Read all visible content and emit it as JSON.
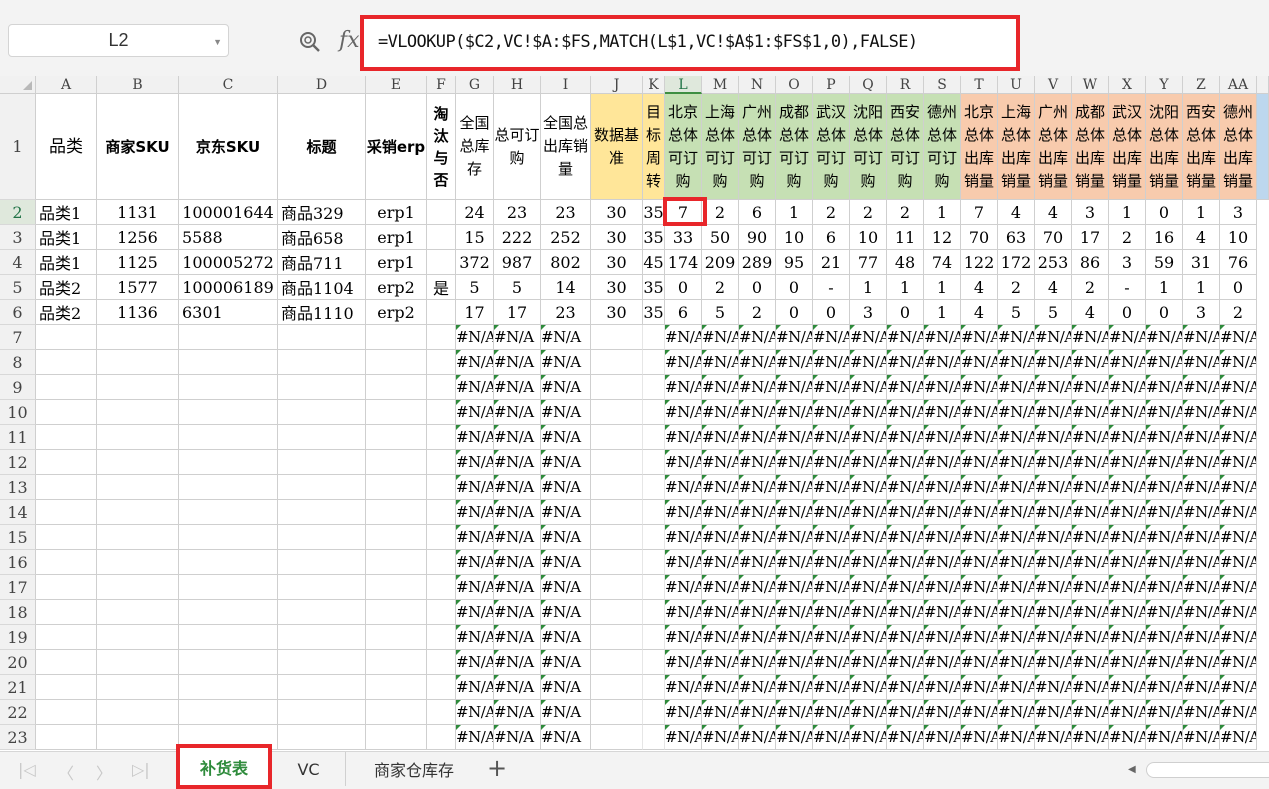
{
  "formula_bar": {
    "name_box": "L2",
    "fx_label": "fx",
    "formula": "=VLOOKUP($C2,VC!$A:$FS,MATCH(L$1,VC!$A$1:$FS$1,0),FALSE)"
  },
  "columns": [
    "A",
    "B",
    "C",
    "D",
    "E",
    "F",
    "G",
    "H",
    "I",
    "J",
    "K",
    "L",
    "M",
    "N",
    "O",
    "P",
    "Q",
    "R",
    "S",
    "T",
    "U",
    "V",
    "W",
    "X",
    "Y",
    "Z",
    "AA"
  ],
  "header_row": [
    "品类",
    "商家SKU",
    "京东SKU",
    "标题",
    "采销erp",
    "淘汰与否",
    "全国总库存",
    "总可订购",
    "全国总出库销量",
    "数据基准",
    "目标周转",
    "北京总体可订购",
    "上海总体可订购",
    "广州总体可订购",
    "成都总体可订购",
    "武汉总体可订购",
    "沈阳总体可订购",
    "西安总体可订购",
    "德州总体可订购",
    "北京总体出库销量",
    "上海总体出库销量",
    "广州总体出库销量",
    "成都总体出库销量",
    "武汉总体出库销量",
    "沈阳总体出库销量",
    "西安总体出库销量",
    "德州总体出库销量"
  ],
  "data_rows": [
    [
      "品类1",
      "1131",
      "100001644",
      "商品329",
      "erp1",
      "",
      "24",
      "23",
      "23",
      "30",
      "35",
      "7",
      "2",
      "6",
      "1",
      "2",
      "2",
      "2",
      "1",
      "7",
      "4",
      "4",
      "3",
      "1",
      "0",
      "1",
      "3"
    ],
    [
      "品类1",
      "1256",
      "5588",
      "商品658",
      "erp1",
      "",
      "15",
      "222",
      "252",
      "30",
      "35",
      "33",
      "50",
      "90",
      "10",
      "6",
      "10",
      "11",
      "12",
      "70",
      "63",
      "70",
      "17",
      "2",
      "16",
      "4",
      "10"
    ],
    [
      "品类1",
      "1125",
      "100005272",
      "商品711",
      "erp1",
      "",
      "372",
      "987",
      "802",
      "30",
      "45",
      "174",
      "209",
      "289",
      "95",
      "21",
      "77",
      "48",
      "74",
      "122",
      "172",
      "253",
      "86",
      "3",
      "59",
      "31",
      "76"
    ],
    [
      "品类2",
      "1577",
      "100006189",
      "商品1104",
      "erp2",
      "是",
      "5",
      "5",
      "14",
      "30",
      "35",
      "0",
      "2",
      "0",
      "0",
      "-",
      "1",
      "1",
      "1",
      "4",
      "2",
      "4",
      "2",
      "-",
      "1",
      "1",
      "0"
    ],
    [
      "品类2",
      "1136",
      "6301",
      "商品1110",
      "erp2",
      "",
      "17",
      "17",
      "23",
      "30",
      "35",
      "6",
      "5",
      "2",
      "0",
      "0",
      "3",
      "0",
      "1",
      "4",
      "5",
      "5",
      "4",
      "0",
      "0",
      "3",
      "2"
    ]
  ],
  "na_value": "#N/A",
  "row_numbers": [
    "1",
    "2",
    "3",
    "4",
    "5",
    "6",
    "7",
    "8",
    "9",
    "10",
    "11",
    "12",
    "13",
    "14",
    "15",
    "16",
    "17",
    "18",
    "19",
    "20",
    "21",
    "22",
    "23"
  ],
  "header_colors": {
    "yellow": "#ffe699",
    "green": "#c6e0b4",
    "orange": "#f8cbad",
    "blue": "#bdd7ee",
    "accent_red": "#e8262a",
    "sheet_green": "#2e8b3b"
  },
  "sheet_tabs": [
    "补货表",
    "VC",
    "商家仓库存"
  ],
  "active_tab": "补货表",
  "add_tab_label": "+"
}
